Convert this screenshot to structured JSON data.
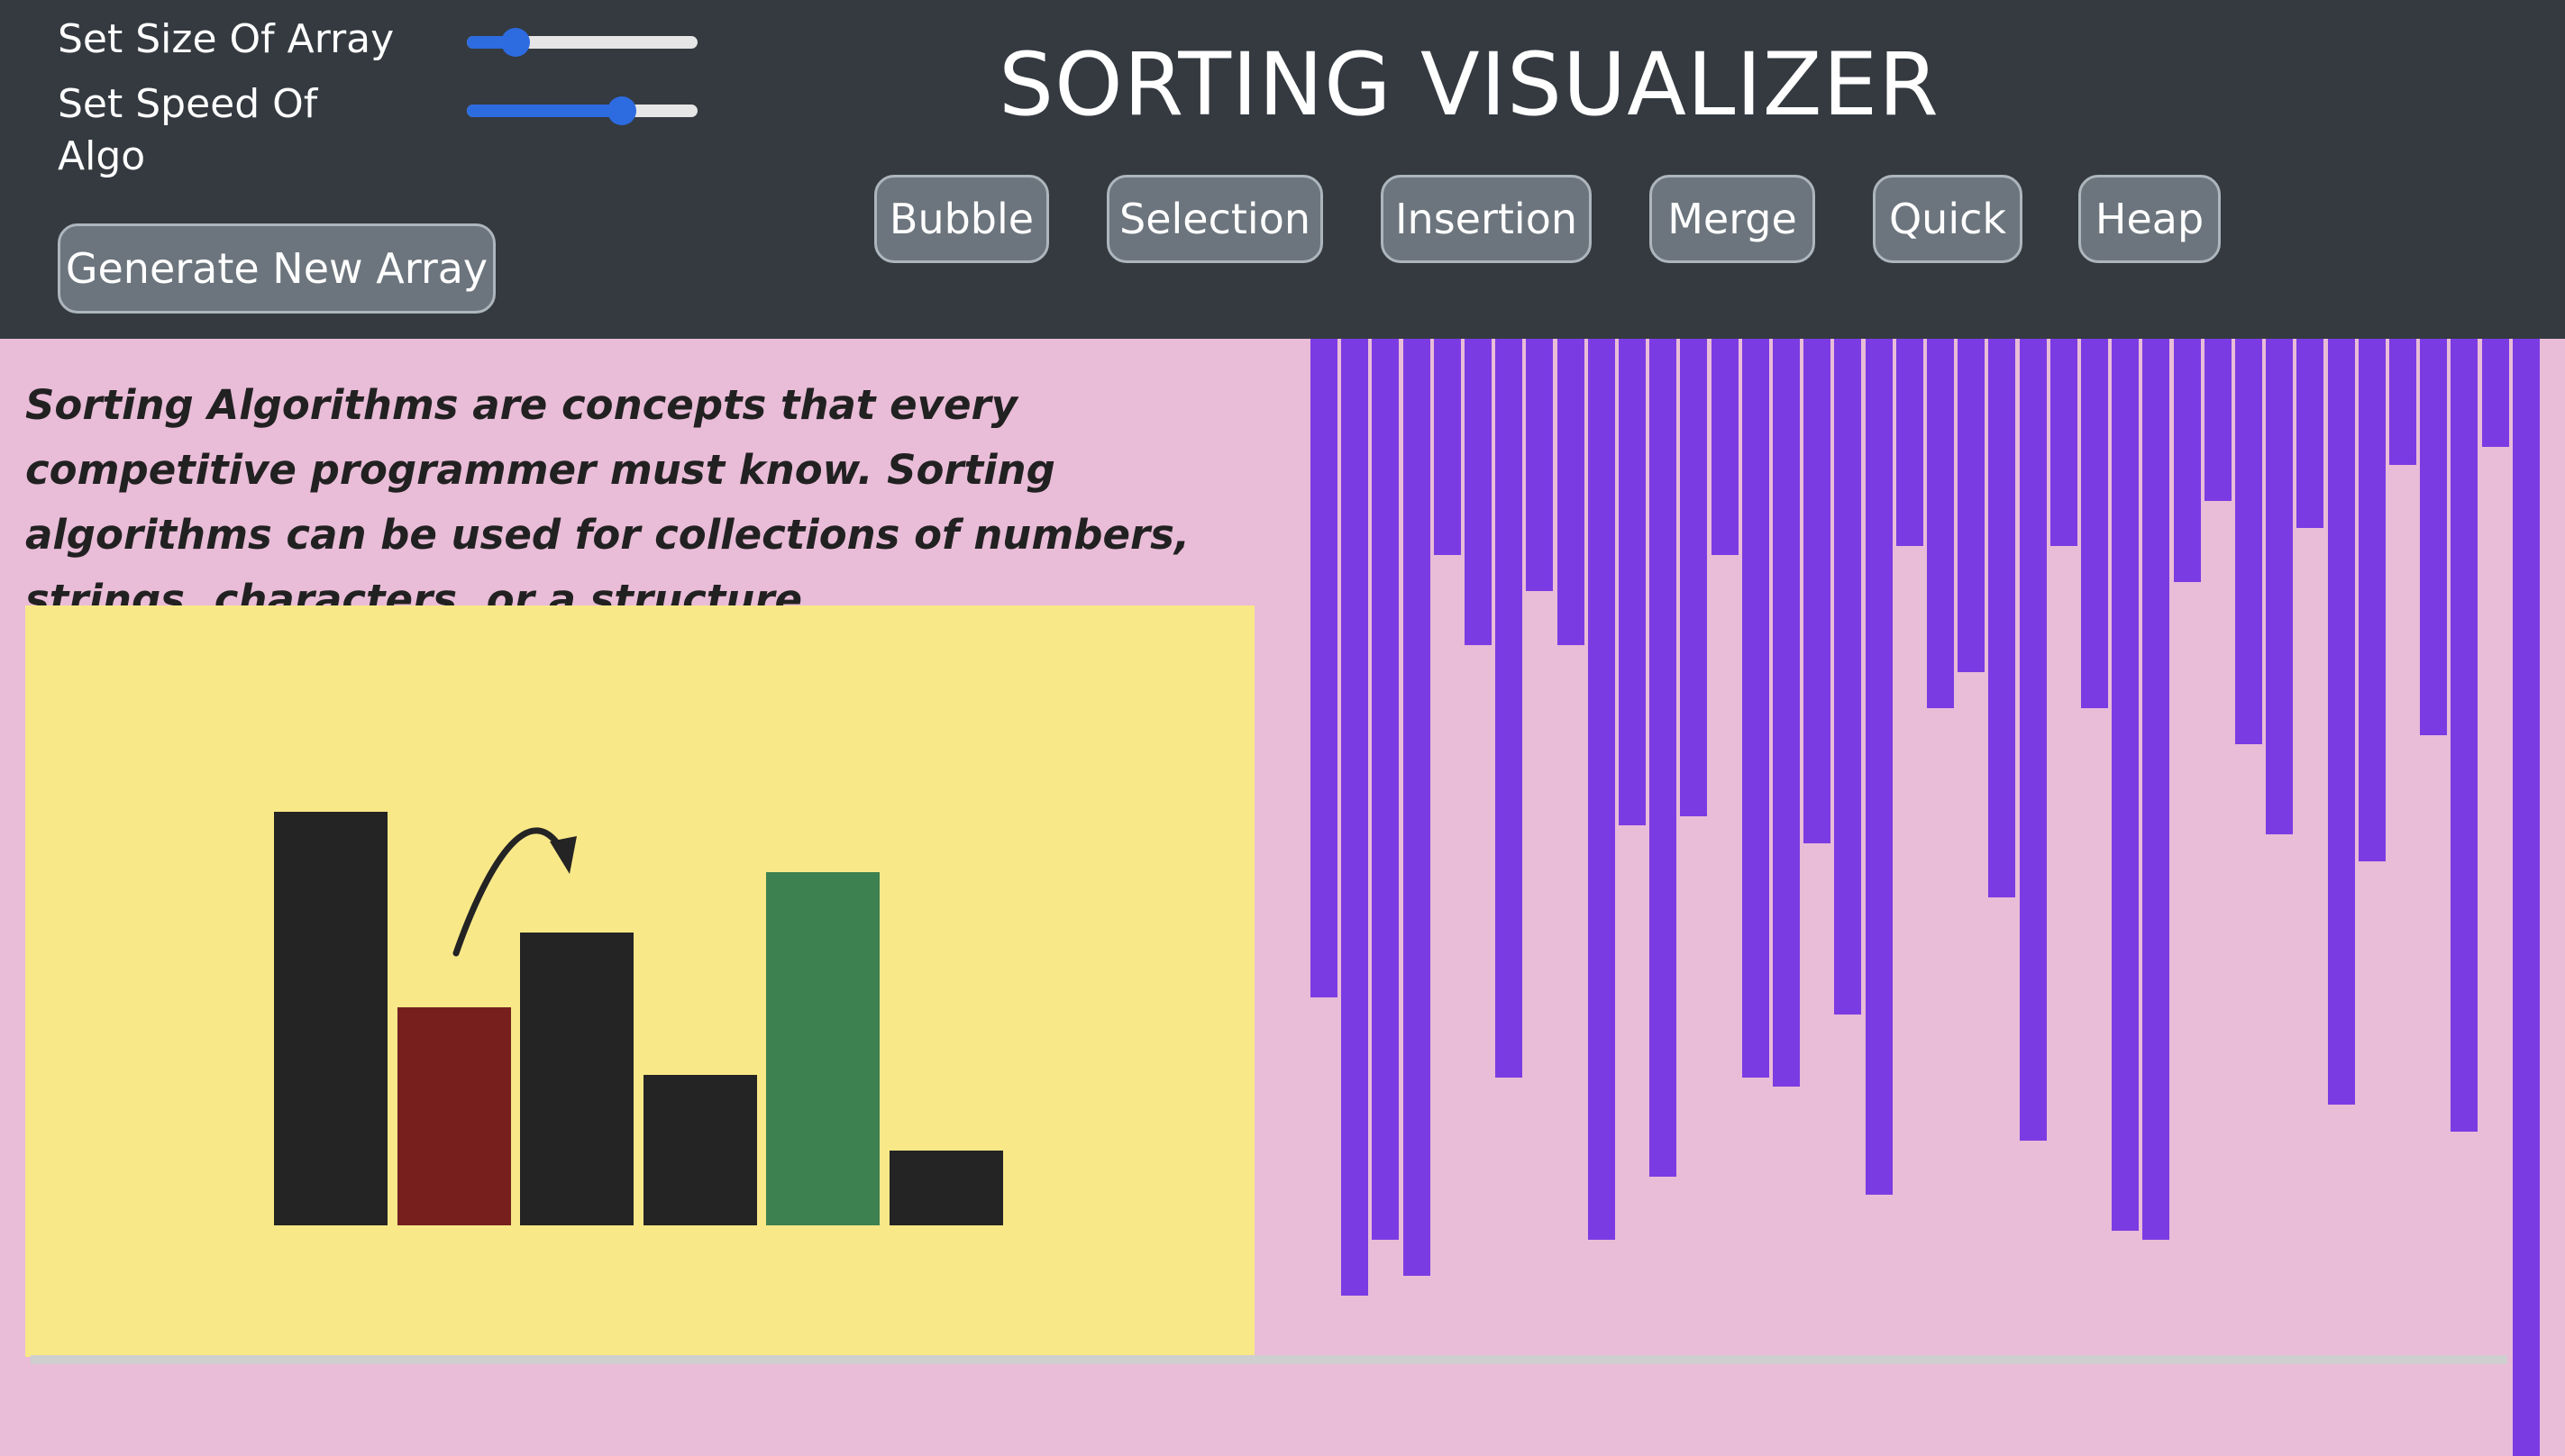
{
  "header": {
    "title": "SORTING VISUALIZER",
    "size_label": "Set Size Of Array",
    "speed_label_line1": "Set Speed Of",
    "speed_label_line2": "Algo",
    "size_value_fraction": 0.21,
    "speed_value_fraction": 0.67,
    "generate_label": "Generate New Array",
    "algorithms": [
      "Bubble",
      "Selection",
      "Insertion",
      "Merge",
      "Quick",
      "Heap"
    ]
  },
  "description": "Sorting Algorithms are concepts that every competitive programmer must know. Sorting algorithms can be used for collections of numbers, strings, characters, or a structure",
  "illustration": {
    "bar_colors": [
      "#242424",
      "#761f1d",
      "#242424",
      "#242424",
      "#3d8150",
      "#242424"
    ],
    "bar_heights": [
      0.55,
      0.29,
      0.39,
      0.2,
      0.47,
      0.1
    ],
    "arrow_color": "#242424",
    "background": "#f9e888"
  },
  "array": {
    "bar_color": "#7b3be3",
    "values": [
      731,
      1062,
      1000,
      1040,
      240,
      340,
      820,
      280,
      340,
      1000,
      540,
      930,
      530,
      240,
      820,
      830,
      560,
      750,
      950,
      230,
      410,
      370,
      620,
      890,
      230,
      410,
      990,
      1000,
      270,
      180,
      450,
      550,
      210,
      850,
      580,
      140,
      440,
      880,
      120,
      1240
    ]
  }
}
